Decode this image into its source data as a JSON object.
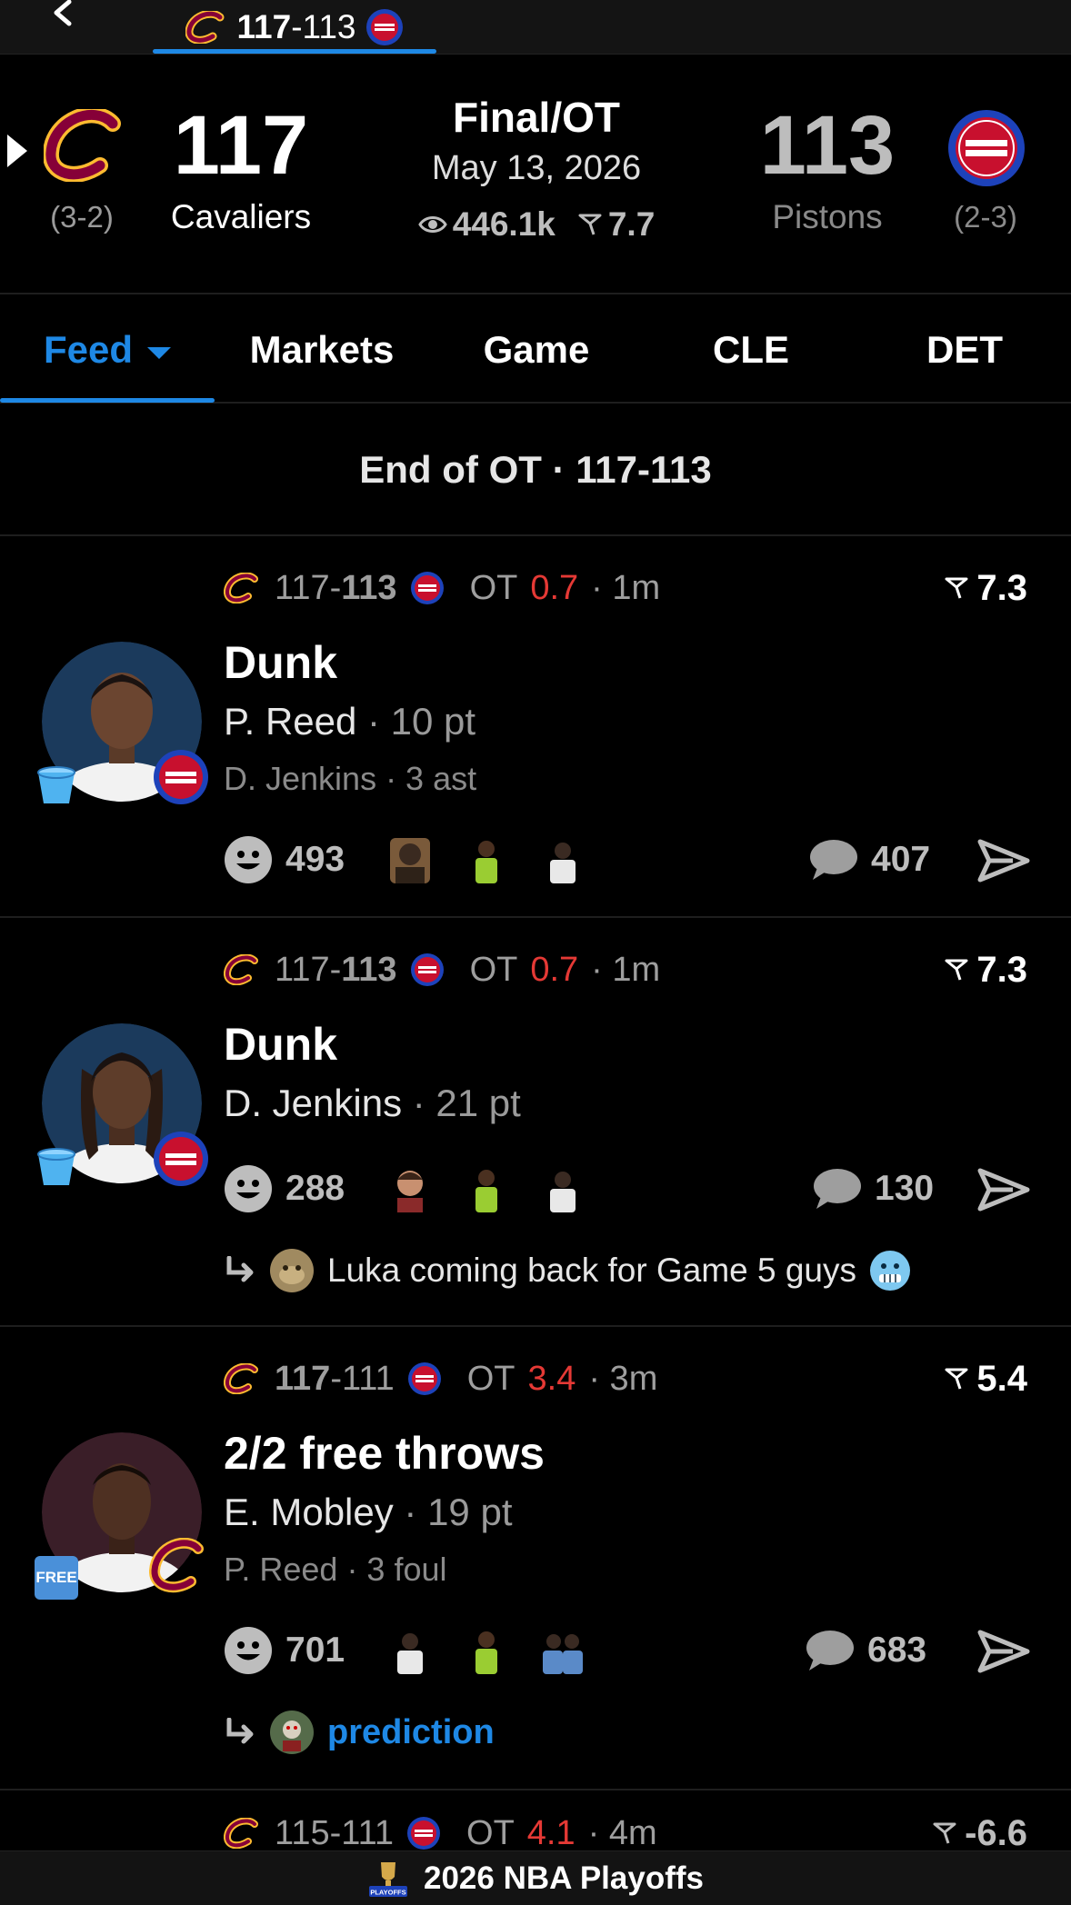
{
  "topnav": {
    "score_home": "117",
    "score_sep": "-",
    "score_away": "113"
  },
  "scoreboard": {
    "home": {
      "score": "117",
      "name": "Cavaliers",
      "record": "(3-2)"
    },
    "away": {
      "score": "113",
      "name": "Pistons",
      "record": "(2-3)"
    },
    "status": "Final/OT",
    "date": "May 13, 2026",
    "views": "446.1k",
    "rating": "7.7"
  },
  "tabs": [
    {
      "label": "Feed"
    },
    {
      "label": "Markets"
    },
    {
      "label": "Game"
    },
    {
      "label": "CLE"
    },
    {
      "label": "DET"
    }
  ],
  "section_header": "End of OT · 117-113",
  "feed": [
    {
      "score_home": "117",
      "score_sep": "-",
      "score_away": "113",
      "period": "OT",
      "clock": "0.7",
      "ago": "· 1m",
      "rating": "7.3",
      "title": "Dunk",
      "player": "P. Reed",
      "player_stat": "· 10 pt",
      "secondary": "D. Jenkins · 3 ast",
      "reactions": "493",
      "comments": "407"
    },
    {
      "score_home": "117",
      "score_sep": "-",
      "score_away": "113",
      "period": "OT",
      "clock": "0.7",
      "ago": "· 1m",
      "rating": "7.3",
      "title": "Dunk",
      "player": "D. Jenkins",
      "player_stat": "· 21 pt",
      "reactions": "288",
      "comments": "130",
      "reply": "Luka coming back for Game 5 guys"
    },
    {
      "score_home": "117",
      "score_sep": "-",
      "score_away": "111",
      "period": "OT",
      "clock": "3.4",
      "ago": "· 3m",
      "rating": "5.4",
      "title": "2/2 free throws",
      "player": "E. Mobley",
      "player_stat": "· 19 pt",
      "secondary": "P. Reed · 3 foul",
      "reactions": "701",
      "comments": "683",
      "reply": "prediction",
      "badge": "FREE"
    },
    {
      "score_home": "115",
      "score_sep": "-",
      "score_away": "111",
      "period": "OT",
      "clock": "4.1",
      "ago": "· 4m",
      "rating": "-6.6"
    }
  ],
  "bottombar": {
    "label": "2026 NBA Playoffs",
    "logo_text": "PLAYOFFS"
  },
  "colors": {
    "accent": "#1e88e5",
    "red": "#e53935",
    "cavs_wine": "#860038",
    "cavs_gold": "#FDBB30",
    "pistons_blue": "#1d42ba",
    "pistons_red": "#c8102e"
  }
}
